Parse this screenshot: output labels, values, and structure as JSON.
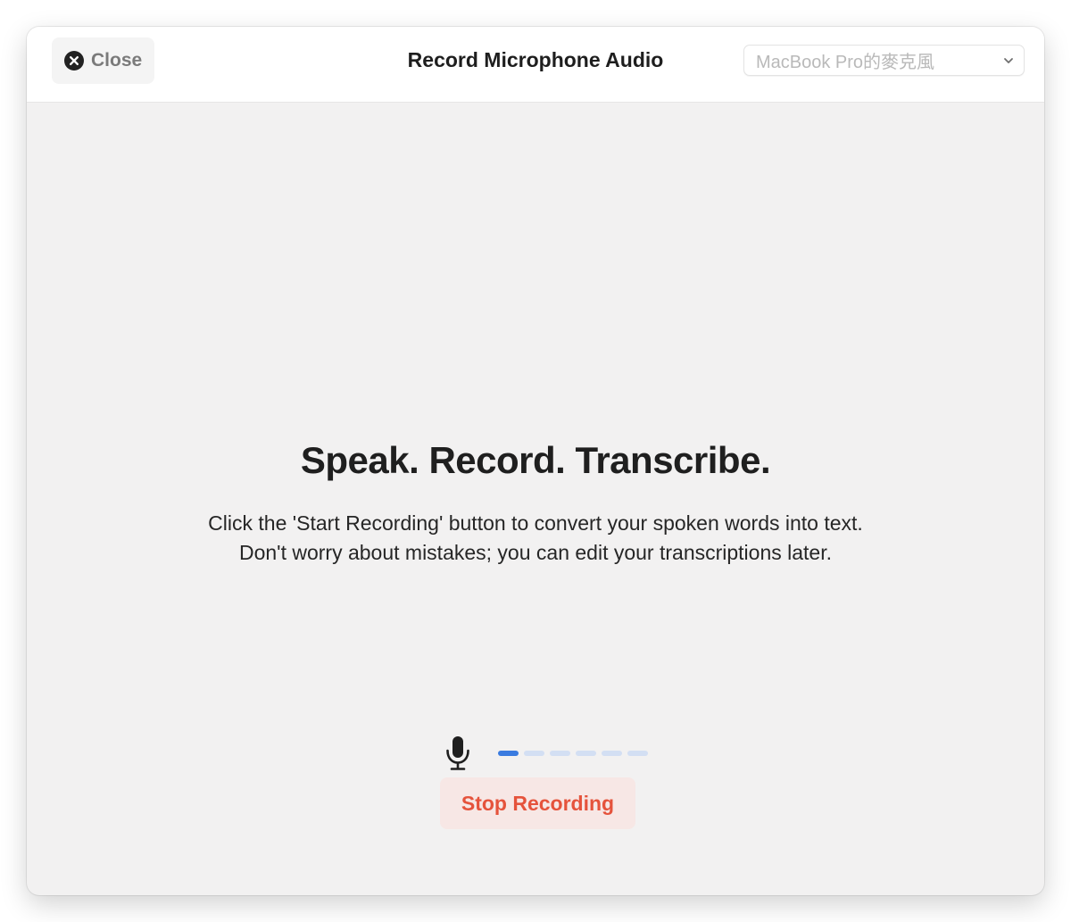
{
  "window": {
    "title": "Record Microphone Audio"
  },
  "toolbar": {
    "close_label": "Close",
    "close_icon": "close-circle-icon"
  },
  "device": {
    "selected": "MacBook Pro的麥克風",
    "icon": "chevron-down-icon"
  },
  "main": {
    "headline": "Speak. Record. Transcribe.",
    "description_line1": "Click the 'Start Recording' button to convert your spoken words into text.",
    "description_line2": "Don't worry about mistakes; you can edit your transcriptions later."
  },
  "recorder": {
    "mic_icon": "microphone-icon",
    "level_segments": 6,
    "level_active": 1,
    "stop_label": "Stop Recording"
  },
  "colors": {
    "accent": "#3a7be0",
    "level_inactive": "#d3dff3",
    "stop_text": "#e5533c",
    "stop_bg": "#f7e7e5"
  }
}
